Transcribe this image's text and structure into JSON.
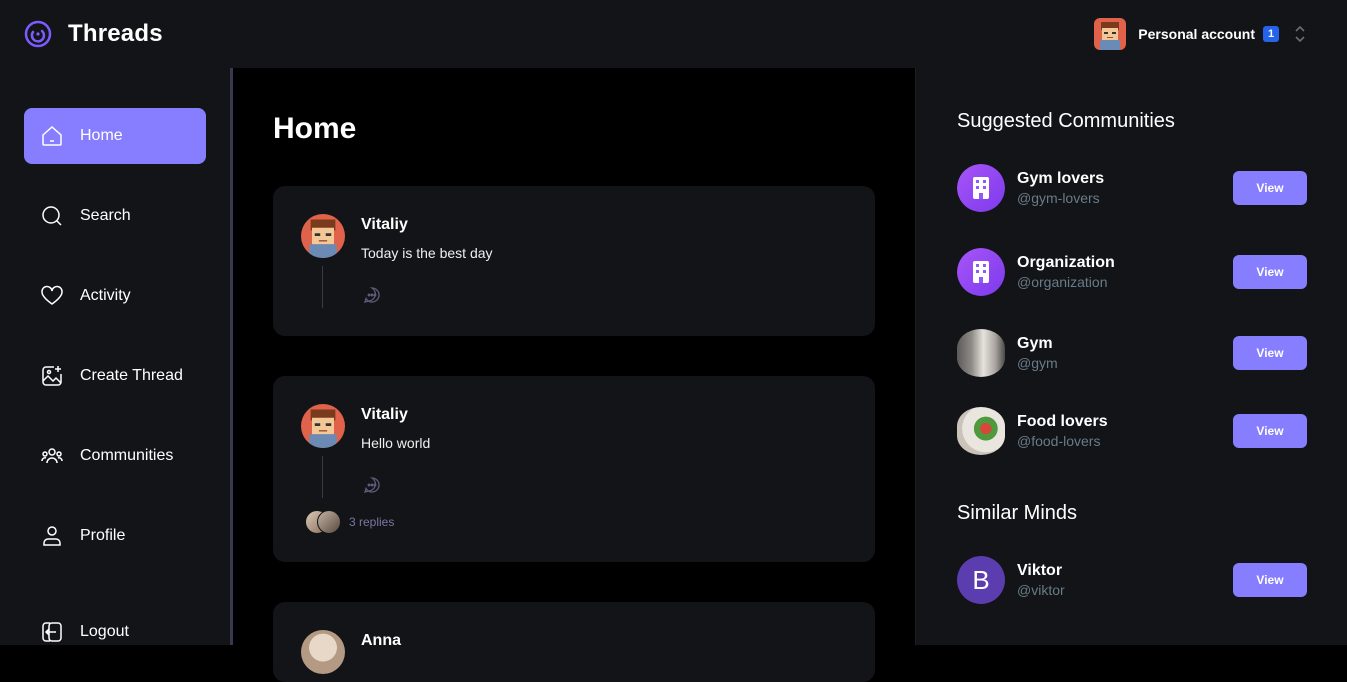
{
  "app": {
    "title": "Threads"
  },
  "account": {
    "name": "Personal account",
    "badge": "1"
  },
  "nav": {
    "items": [
      {
        "label": "Home",
        "icon": "home-icon",
        "active": true
      },
      {
        "label": "Search",
        "icon": "search-icon"
      },
      {
        "label": "Activity",
        "icon": "heart-icon"
      },
      {
        "label": "Create Thread",
        "icon": "gallery-add-icon"
      },
      {
        "label": "Communities",
        "icon": "users-icon"
      },
      {
        "label": "Profile",
        "icon": "user-icon"
      }
    ],
    "logout": "Logout"
  },
  "main": {
    "title": "Home",
    "threads": [
      {
        "author": "Vitaliy",
        "content": "Today is the best day"
      },
      {
        "author": "Vitaliy",
        "content": "Hello world",
        "replies": "3 replies"
      },
      {
        "author": "Anna",
        "content": ""
      }
    ]
  },
  "right": {
    "communities_title": "Suggested Communities",
    "communities": [
      {
        "name": "Gym lovers",
        "handle": "@gym-lovers",
        "button": "View"
      },
      {
        "name": "Organization",
        "handle": "@organization",
        "button": "View"
      },
      {
        "name": "Gym",
        "handle": "@gym",
        "button": "View"
      },
      {
        "name": "Food lovers",
        "handle": "@food-lovers",
        "button": "View"
      }
    ],
    "minds_title": "Similar Minds",
    "minds": [
      {
        "name": "Viktor",
        "handle": "@viktor",
        "initial": "B",
        "button": "View"
      }
    ]
  },
  "colors": {
    "accent": "#877eff",
    "panel": "#121417",
    "badge": "#2563eb"
  }
}
